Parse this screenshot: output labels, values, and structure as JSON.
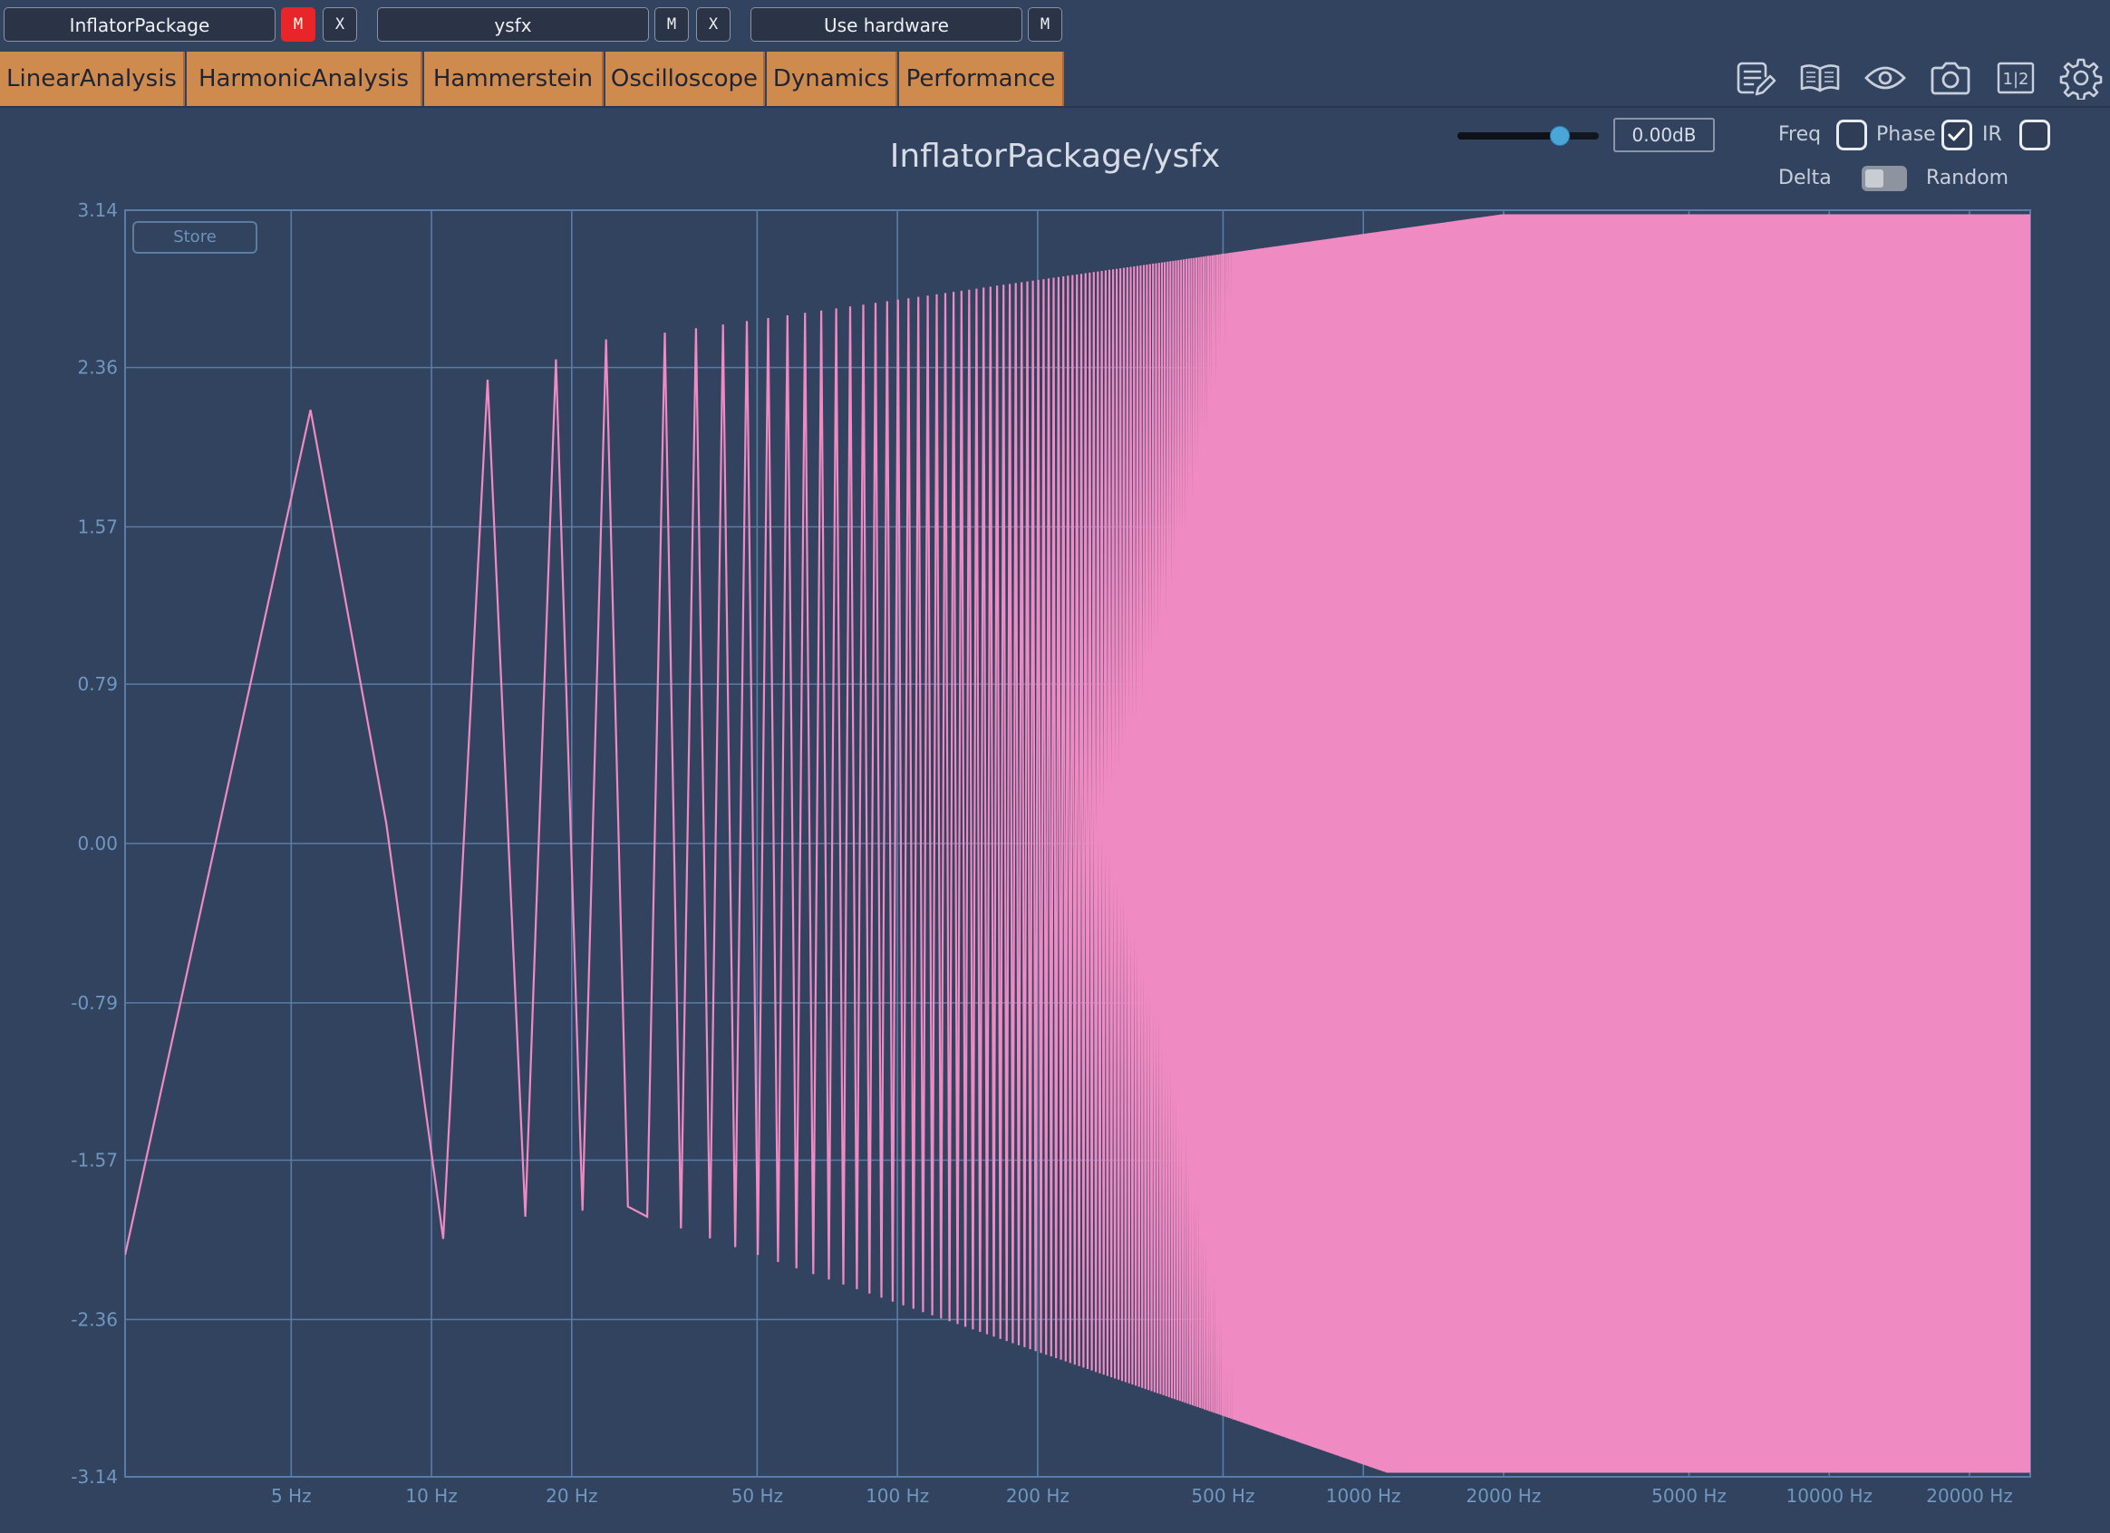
{
  "top_bar": {
    "slots": [
      {
        "label": "InflatorPackage",
        "mute": "M",
        "close": "X",
        "mute_active": true
      },
      {
        "label": "ysfx",
        "mute": "M",
        "close": "X",
        "mute_active": false
      },
      {
        "label": "Use hardware",
        "mute": "M",
        "mute_active": false
      }
    ]
  },
  "tabs": [
    "LinearAnalysis",
    "HarmonicAnalysis",
    "Hammerstein",
    "Oscilloscope",
    "Dynamics",
    "Performance"
  ],
  "toolbar_icons": [
    "notes-icon",
    "book-icon",
    "eye-icon",
    "camera-icon",
    "split-view-icon",
    "gear-icon"
  ],
  "split_icon_text": "1|2",
  "title": "InflatorPackage/ysfx",
  "gain": {
    "value_text": "0.00dB",
    "level": 0.72
  },
  "options": {
    "freq": {
      "label": "Freq",
      "checked": false
    },
    "phase": {
      "label": "Phase",
      "checked": true
    },
    "ir": {
      "label": "IR",
      "checked": false
    },
    "delta": {
      "label": "Delta"
    },
    "random": {
      "label": "Random",
      "on": false
    }
  },
  "store_label": "Store",
  "colors": {
    "background": "#324360",
    "grid": "#5a7da6",
    "curve": "#f08ac2",
    "tab": "#cf8a4e",
    "mute_active": "#e8262a"
  },
  "chart_data": {
    "type": "line",
    "title": "InflatorPackage/ysfx",
    "xscale": "log",
    "xlim": [
      2.2,
      27000
    ],
    "ylim": [
      -3.14,
      3.14
    ],
    "x_ticks": [
      {
        "value": 5,
        "label": "5 Hz"
      },
      {
        "value": 10,
        "label": "10 Hz"
      },
      {
        "value": 20,
        "label": "20 Hz"
      },
      {
        "value": 50,
        "label": "50 Hz"
      },
      {
        "value": 100,
        "label": "100 Hz"
      },
      {
        "value": 200,
        "label": "200 Hz"
      },
      {
        "value": 500,
        "label": "500 Hz"
      },
      {
        "value": 1000,
        "label": "1000 Hz"
      },
      {
        "value": 2000,
        "label": "2000 Hz"
      },
      {
        "value": 5000,
        "label": "5000 Hz"
      },
      {
        "value": 10000,
        "label": "10000 Hz"
      },
      {
        "value": 20000,
        "label": "20000 Hz"
      }
    ],
    "y_ticks": [
      {
        "value": 3.14,
        "label": "3.14"
      },
      {
        "value": 2.36,
        "label": "2.36"
      },
      {
        "value": 1.57,
        "label": "1.57"
      },
      {
        "value": 0.79,
        "label": "0.79"
      },
      {
        "value": 0.0,
        "label": "0.00"
      },
      {
        "value": -0.79,
        "label": "-0.79"
      },
      {
        "value": -1.57,
        "label": "-1.57"
      },
      {
        "value": -2.36,
        "label": "-2.36"
      },
      {
        "value": -3.14,
        "label": "-3.14"
      }
    ],
    "series": [
      {
        "description": "wrapped phase sawtooth, peak/trough vertices for the low-frequency section",
        "x": [
          2.2,
          5.5,
          8.0,
          10.6,
          13.2,
          15.9,
          18.5,
          21.1,
          23.7,
          26.4
        ],
        "y": [
          -2.04,
          2.15,
          0.1,
          -1.96,
          2.3,
          -1.85,
          2.4,
          -1.82,
          2.5,
          -1.8
        ]
      }
    ]
  }
}
